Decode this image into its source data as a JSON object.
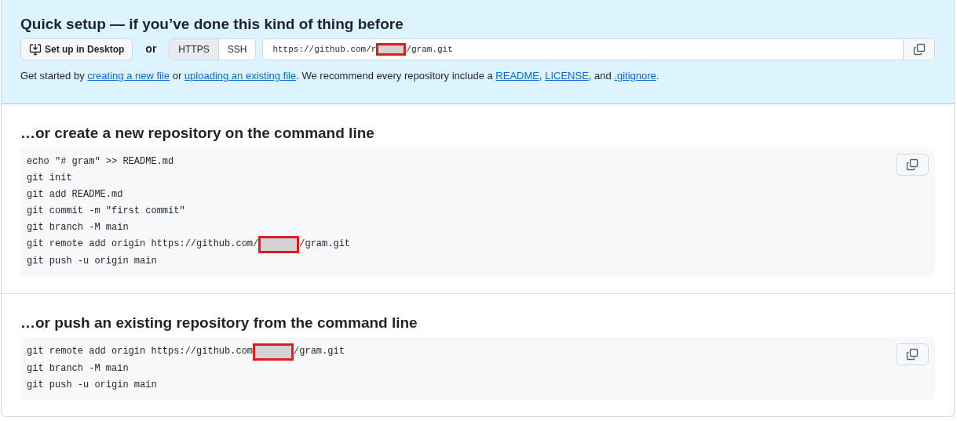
{
  "quick_setup": {
    "title": "Quick setup — if you’ve done this kind of thing before",
    "desktop_button": "Set up in Desktop",
    "or_label": "or",
    "protocols": [
      {
        "label": "HTTPS",
        "selected": true
      },
      {
        "label": "SSH",
        "selected": false
      }
    ],
    "url": [
      {
        "kind": "text",
        "text": "https://github.com/r"
      },
      {
        "kind": "redaction"
      },
      {
        "kind": "text",
        "text": "/gram.git"
      }
    ],
    "hint": [
      {
        "kind": "text",
        "text": "Get started by "
      },
      {
        "kind": "link",
        "text": "creating a new file"
      },
      {
        "kind": "text",
        "text": " or "
      },
      {
        "kind": "link",
        "text": "uploading an existing file"
      },
      {
        "kind": "text",
        "text": ". We recommend every repository include a "
      },
      {
        "kind": "link",
        "text": "README"
      },
      {
        "kind": "text",
        "text": ", "
      },
      {
        "kind": "link",
        "text": "LICENSE"
      },
      {
        "kind": "text",
        "text": ", and "
      },
      {
        "kind": "link",
        "text": ".gitignore"
      },
      {
        "kind": "text",
        "text": "."
      }
    ]
  },
  "sections": [
    {
      "title": "…or create a new repository on the command line",
      "lines": [
        [
          {
            "kind": "text",
            "text": "echo \"# gram\" >> README.md"
          }
        ],
        [
          {
            "kind": "text",
            "text": "git init"
          }
        ],
        [
          {
            "kind": "text",
            "text": "git add README.md"
          }
        ],
        [
          {
            "kind": "text",
            "text": "git commit -m \"first commit\""
          }
        ],
        [
          {
            "kind": "text",
            "text": "git branch -M main"
          }
        ],
        [
          {
            "kind": "text",
            "text": "git remote add origin https://github.com/"
          },
          {
            "kind": "redaction"
          },
          {
            "kind": "text",
            "text": "/gram.git"
          }
        ],
        [
          {
            "kind": "text",
            "text": "git push -u origin main"
          }
        ]
      ]
    },
    {
      "title": "…or push an existing repository from the command line",
      "lines": [
        [
          {
            "kind": "text",
            "text": "git remote add origin https://github.com"
          },
          {
            "kind": "redaction"
          },
          {
            "kind": "text",
            "text": "/gram.git"
          }
        ],
        [
          {
            "kind": "text",
            "text": "git branch -M main"
          }
        ],
        [
          {
            "kind": "text",
            "text": "git push -u origin main"
          }
        ]
      ]
    }
  ]
}
